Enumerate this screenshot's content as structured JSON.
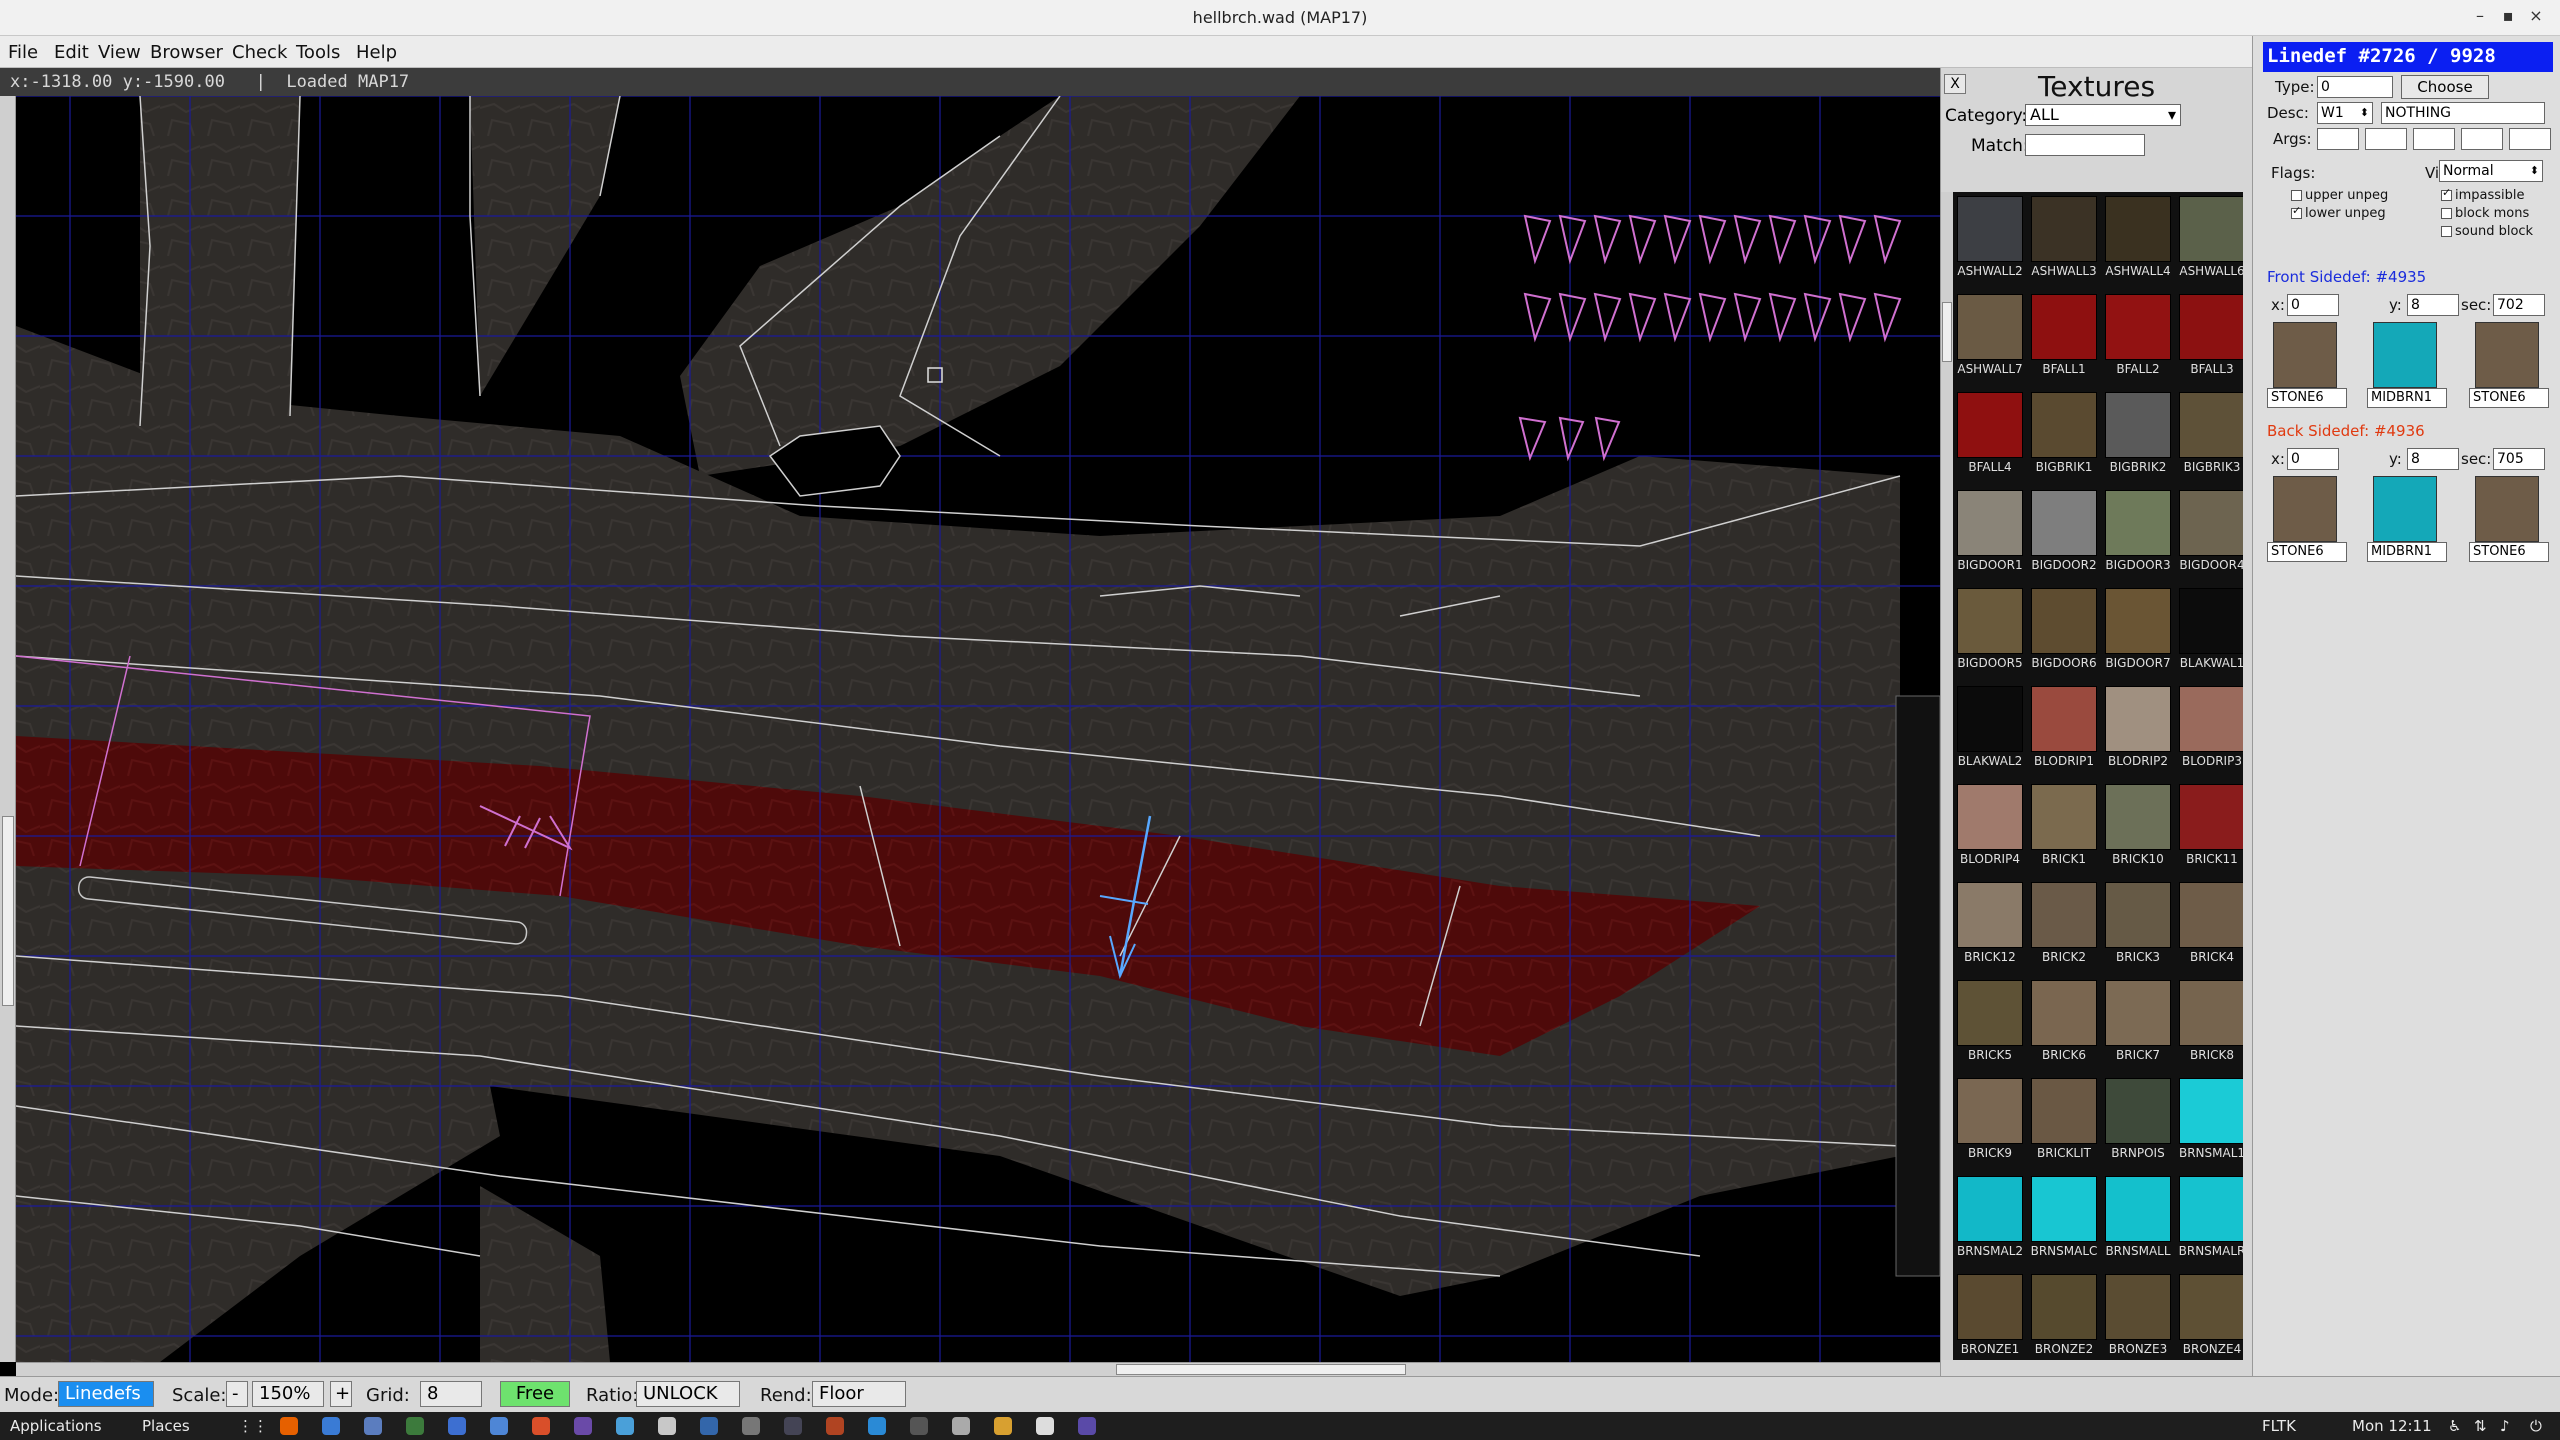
{
  "window": {
    "title": "hellbrch.wad (MAP17)"
  },
  "menu": [
    "File",
    "Edit",
    "View",
    "Browser",
    "Check",
    "Tools",
    "Help"
  ],
  "status": {
    "text": "x:-1318.00 y:-1590.00   |  Loaded MAP17"
  },
  "textures": {
    "title": "Textures",
    "category_label": "Category:",
    "category_value": "ALL",
    "match_label": "Match:",
    "match_value": "",
    "items": [
      {
        "name": "ASHWALL2",
        "color": "#3d3f44"
      },
      {
        "name": "ASHWALL3",
        "color": "#3b3225"
      },
      {
        "name": "ASHWALL4",
        "color": "#3a3120"
      },
      {
        "name": "ASHWALL6",
        "color": "#5b614a"
      },
      {
        "name": "ASHWALL7",
        "color": "#6a5a44"
      },
      {
        "name": "BFALL1",
        "color": "#8e1010"
      },
      {
        "name": "BFALL2",
        "color": "#921212"
      },
      {
        "name": "BFALL3",
        "color": "#8c1111"
      },
      {
        "name": "BFALL4",
        "color": "#8f1010"
      },
      {
        "name": "BIGBRIK1",
        "color": "#5a4a30"
      },
      {
        "name": "BIGBRIK2",
        "color": "#5a5a5a"
      },
      {
        "name": "BIGBRIK3",
        "color": "#5e5138"
      },
      {
        "name": "BIGDOOR1",
        "color": "#8a8478"
      },
      {
        "name": "BIGDOOR2",
        "color": "#7e7e7e"
      },
      {
        "name": "BIGDOOR3",
        "color": "#6e7a5a"
      },
      {
        "name": "BIGDOOR4",
        "color": "#6d6450"
      },
      {
        "name": "BIGDOOR5",
        "color": "#6a5a3c"
      },
      {
        "name": "BIGDOOR6",
        "color": "#5e4c30"
      },
      {
        "name": "BIGDOOR7",
        "color": "#6a5534"
      },
      {
        "name": "BLAKWAL1",
        "color": "#0c0c0c"
      },
      {
        "name": "BLAKWAL2",
        "color": "#0b0b0b"
      },
      {
        "name": "BLODRIP1",
        "color": "#9a4a3e"
      },
      {
        "name": "BLODRIP2",
        "color": "#a09080"
      },
      {
        "name": "BLODRIP3",
        "color": "#9a6a5c"
      },
      {
        "name": "BLODRIP4",
        "color": "#a07a6c"
      },
      {
        "name": "BRICK1",
        "color": "#7b6a4e"
      },
      {
        "name": "BRICK10",
        "color": "#6c7058"
      },
      {
        "name": "BRICK11",
        "color": "#8a1c1c"
      },
      {
        "name": "BRICK12",
        "color": "#8a7a68"
      },
      {
        "name": "BRICK2",
        "color": "#6a5a48"
      },
      {
        "name": "BRICK3",
        "color": "#665a46"
      },
      {
        "name": "BRICK4",
        "color": "#6e5c48"
      },
      {
        "name": "BRICK5",
        "color": "#5e5236"
      },
      {
        "name": "BRICK6",
        "color": "#7a6650"
      },
      {
        "name": "BRICK7",
        "color": "#7c6a54"
      },
      {
        "name": "BRICK8",
        "color": "#76644e"
      },
      {
        "name": "BRICK9",
        "color": "#7a6752"
      },
      {
        "name": "BRICKLIT",
        "color": "#6a5844"
      },
      {
        "name": "BRNPOIS",
        "color": "#3e4a3a"
      },
      {
        "name": "BRNSMAL1",
        "color": "#1bcbd6"
      },
      {
        "name": "BRNSMAL2",
        "color": "#12b8c8"
      },
      {
        "name": "BRNSMALC",
        "color": "#18c6d2"
      },
      {
        "name": "BRNSMALL",
        "color": "#14c0cc"
      },
      {
        "name": "BRNSMALR",
        "color": "#16c2cf"
      },
      {
        "name": "BRONZE1",
        "color": "#5a4a30"
      },
      {
        "name": "BRONZE2",
        "color": "#564a2e"
      },
      {
        "name": "BRONZE3",
        "color": "#5a4c32"
      },
      {
        "name": "BRONZE4",
        "color": "#5e5034"
      }
    ]
  },
  "linedef": {
    "header": "Linedef #2726 / 9928",
    "type_label": "Type:",
    "type_value": "0",
    "choose_label": "Choose",
    "desc_label": "Desc:",
    "desc_trigger": "W1",
    "desc_value": "NOTHING",
    "args_label": "Args:",
    "flags_label": "Flags:",
    "vis_label": "Vis:",
    "vis_value": "Normal",
    "flags": {
      "upper_unpeg": {
        "label": "upper unpeg",
        "on": false
      },
      "lower_unpeg": {
        "label": "lower unpeg",
        "on": true
      },
      "impassible": {
        "label": "impassible",
        "on": true
      },
      "block_mons": {
        "label": "block mons",
        "on": false
      },
      "sound_block": {
        "label": "sound block",
        "on": false
      }
    },
    "front": {
      "title": "Front Sidedef: #4935",
      "title_color": "#1a2cdc",
      "x": "0",
      "y": "8",
      "sec": "702",
      "upper": "STONE6",
      "mid": "MIDBRN1",
      "lower": "STONE6"
    },
    "back": {
      "title": "Back Sidedef: #4936",
      "title_color": "#e03a10",
      "x": "0",
      "y": "8",
      "sec": "705",
      "upper": "STONE6",
      "mid": "MIDBRN1",
      "lower": "STONE6"
    },
    "x_label": "x:",
    "y_label": "y:",
    "sec_label": "sec:"
  },
  "bottombar": {
    "mode_label": "Mode:",
    "mode_value": "Linedefs",
    "scale_label": "Scale:",
    "scale_minus": "-",
    "scale_value": "150%",
    "scale_plus": "+",
    "grid_label": "Grid:",
    "grid_value": "8",
    "free_label": "Free",
    "ratio_label": "Ratio:",
    "ratio_value": "UNLOCK",
    "rend_label": "Rend:",
    "rend_value": "Floor"
  },
  "taskbar": {
    "applications": "Applications",
    "places": "Places",
    "fltk": "FLTK",
    "clock": "Mon 12:11"
  },
  "colors": {
    "accent_header": "#0b1ff2",
    "sector_selected": "#5a0a0a",
    "grid": "#1a1a9a",
    "free_button": "#6ee26e",
    "mode_button": "#1a8ef0"
  }
}
